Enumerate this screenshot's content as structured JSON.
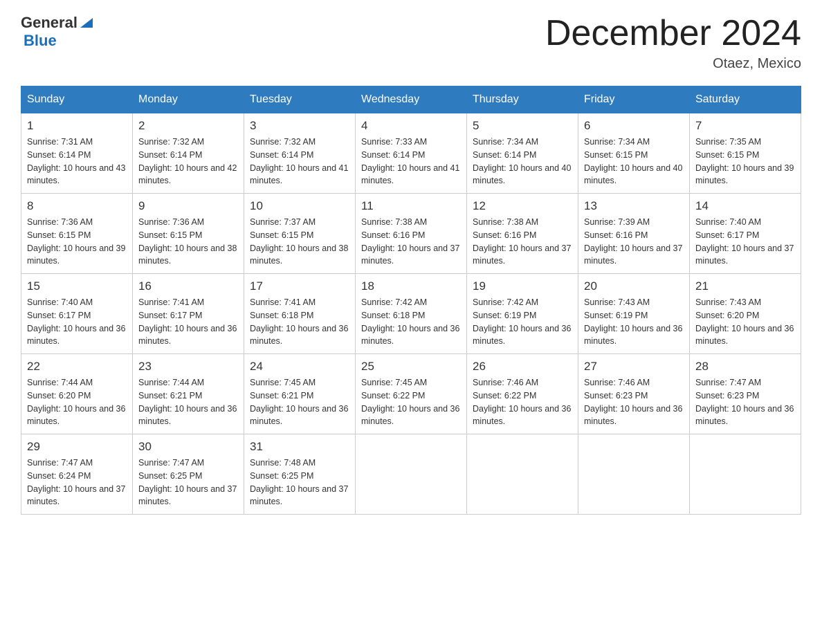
{
  "header": {
    "logo": {
      "general": "General",
      "blue": "Blue",
      "alt": "GeneralBlue Logo"
    },
    "title": "December 2024",
    "location": "Otaez, Mexico"
  },
  "calendar": {
    "days_of_week": [
      "Sunday",
      "Monday",
      "Tuesday",
      "Wednesday",
      "Thursday",
      "Friday",
      "Saturday"
    ],
    "weeks": [
      [
        {
          "day": "1",
          "sunrise": "Sunrise: 7:31 AM",
          "sunset": "Sunset: 6:14 PM",
          "daylight": "Daylight: 10 hours and 43 minutes."
        },
        {
          "day": "2",
          "sunrise": "Sunrise: 7:32 AM",
          "sunset": "Sunset: 6:14 PM",
          "daylight": "Daylight: 10 hours and 42 minutes."
        },
        {
          "day": "3",
          "sunrise": "Sunrise: 7:32 AM",
          "sunset": "Sunset: 6:14 PM",
          "daylight": "Daylight: 10 hours and 41 minutes."
        },
        {
          "day": "4",
          "sunrise": "Sunrise: 7:33 AM",
          "sunset": "Sunset: 6:14 PM",
          "daylight": "Daylight: 10 hours and 41 minutes."
        },
        {
          "day": "5",
          "sunrise": "Sunrise: 7:34 AM",
          "sunset": "Sunset: 6:14 PM",
          "daylight": "Daylight: 10 hours and 40 minutes."
        },
        {
          "day": "6",
          "sunrise": "Sunrise: 7:34 AM",
          "sunset": "Sunset: 6:15 PM",
          "daylight": "Daylight: 10 hours and 40 minutes."
        },
        {
          "day": "7",
          "sunrise": "Sunrise: 7:35 AM",
          "sunset": "Sunset: 6:15 PM",
          "daylight": "Daylight: 10 hours and 39 minutes."
        }
      ],
      [
        {
          "day": "8",
          "sunrise": "Sunrise: 7:36 AM",
          "sunset": "Sunset: 6:15 PM",
          "daylight": "Daylight: 10 hours and 39 minutes."
        },
        {
          "day": "9",
          "sunrise": "Sunrise: 7:36 AM",
          "sunset": "Sunset: 6:15 PM",
          "daylight": "Daylight: 10 hours and 38 minutes."
        },
        {
          "day": "10",
          "sunrise": "Sunrise: 7:37 AM",
          "sunset": "Sunset: 6:15 PM",
          "daylight": "Daylight: 10 hours and 38 minutes."
        },
        {
          "day": "11",
          "sunrise": "Sunrise: 7:38 AM",
          "sunset": "Sunset: 6:16 PM",
          "daylight": "Daylight: 10 hours and 37 minutes."
        },
        {
          "day": "12",
          "sunrise": "Sunrise: 7:38 AM",
          "sunset": "Sunset: 6:16 PM",
          "daylight": "Daylight: 10 hours and 37 minutes."
        },
        {
          "day": "13",
          "sunrise": "Sunrise: 7:39 AM",
          "sunset": "Sunset: 6:16 PM",
          "daylight": "Daylight: 10 hours and 37 minutes."
        },
        {
          "day": "14",
          "sunrise": "Sunrise: 7:40 AM",
          "sunset": "Sunset: 6:17 PM",
          "daylight": "Daylight: 10 hours and 37 minutes."
        }
      ],
      [
        {
          "day": "15",
          "sunrise": "Sunrise: 7:40 AM",
          "sunset": "Sunset: 6:17 PM",
          "daylight": "Daylight: 10 hours and 36 minutes."
        },
        {
          "day": "16",
          "sunrise": "Sunrise: 7:41 AM",
          "sunset": "Sunset: 6:17 PM",
          "daylight": "Daylight: 10 hours and 36 minutes."
        },
        {
          "day": "17",
          "sunrise": "Sunrise: 7:41 AM",
          "sunset": "Sunset: 6:18 PM",
          "daylight": "Daylight: 10 hours and 36 minutes."
        },
        {
          "day": "18",
          "sunrise": "Sunrise: 7:42 AM",
          "sunset": "Sunset: 6:18 PM",
          "daylight": "Daylight: 10 hours and 36 minutes."
        },
        {
          "day": "19",
          "sunrise": "Sunrise: 7:42 AM",
          "sunset": "Sunset: 6:19 PM",
          "daylight": "Daylight: 10 hours and 36 minutes."
        },
        {
          "day": "20",
          "sunrise": "Sunrise: 7:43 AM",
          "sunset": "Sunset: 6:19 PM",
          "daylight": "Daylight: 10 hours and 36 minutes."
        },
        {
          "day": "21",
          "sunrise": "Sunrise: 7:43 AM",
          "sunset": "Sunset: 6:20 PM",
          "daylight": "Daylight: 10 hours and 36 minutes."
        }
      ],
      [
        {
          "day": "22",
          "sunrise": "Sunrise: 7:44 AM",
          "sunset": "Sunset: 6:20 PM",
          "daylight": "Daylight: 10 hours and 36 minutes."
        },
        {
          "day": "23",
          "sunrise": "Sunrise: 7:44 AM",
          "sunset": "Sunset: 6:21 PM",
          "daylight": "Daylight: 10 hours and 36 minutes."
        },
        {
          "day": "24",
          "sunrise": "Sunrise: 7:45 AM",
          "sunset": "Sunset: 6:21 PM",
          "daylight": "Daylight: 10 hours and 36 minutes."
        },
        {
          "day": "25",
          "sunrise": "Sunrise: 7:45 AM",
          "sunset": "Sunset: 6:22 PM",
          "daylight": "Daylight: 10 hours and 36 minutes."
        },
        {
          "day": "26",
          "sunrise": "Sunrise: 7:46 AM",
          "sunset": "Sunset: 6:22 PM",
          "daylight": "Daylight: 10 hours and 36 minutes."
        },
        {
          "day": "27",
          "sunrise": "Sunrise: 7:46 AM",
          "sunset": "Sunset: 6:23 PM",
          "daylight": "Daylight: 10 hours and 36 minutes."
        },
        {
          "day": "28",
          "sunrise": "Sunrise: 7:47 AM",
          "sunset": "Sunset: 6:23 PM",
          "daylight": "Daylight: 10 hours and 36 minutes."
        }
      ],
      [
        {
          "day": "29",
          "sunrise": "Sunrise: 7:47 AM",
          "sunset": "Sunset: 6:24 PM",
          "daylight": "Daylight: 10 hours and 37 minutes."
        },
        {
          "day": "30",
          "sunrise": "Sunrise: 7:47 AM",
          "sunset": "Sunset: 6:25 PM",
          "daylight": "Daylight: 10 hours and 37 minutes."
        },
        {
          "day": "31",
          "sunrise": "Sunrise: 7:48 AM",
          "sunset": "Sunset: 6:25 PM",
          "daylight": "Daylight: 10 hours and 37 minutes."
        },
        null,
        null,
        null,
        null
      ]
    ]
  }
}
